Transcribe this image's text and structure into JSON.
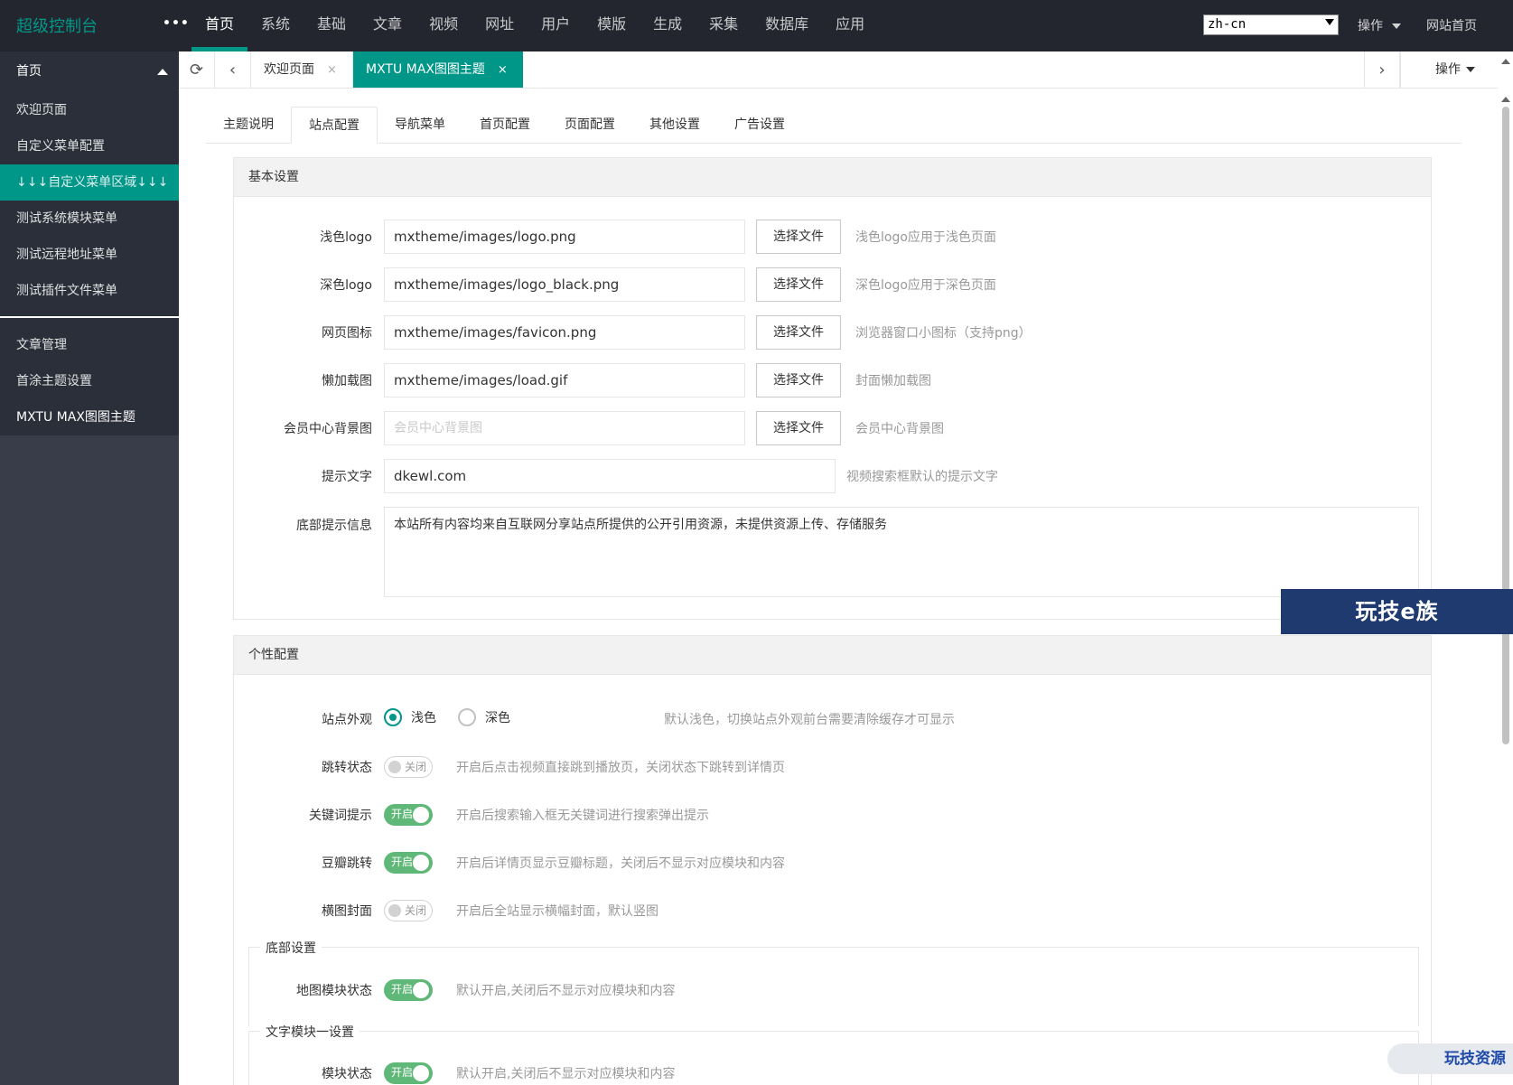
{
  "header": {
    "logo": "超级控制台",
    "more": "•••",
    "nav": [
      "首页",
      "系统",
      "基础",
      "文章",
      "视频",
      "网址",
      "用户",
      "模版",
      "生成",
      "采集",
      "数据库",
      "应用"
    ],
    "lang_value": "zh-cn",
    "operate": "操作",
    "site_home": "网站首页"
  },
  "sidebar": {
    "head": "首页",
    "group1": [
      "欢迎页面",
      "自定义菜单配置",
      "↓↓↓自定义菜单区域↓↓↓",
      "测试系统模块菜单",
      "测试远程地址菜单",
      "测试插件文件菜单"
    ],
    "group2": [
      "文章管理",
      "首涂主题设置",
      "MXTU MAX图图主题"
    ]
  },
  "tabbar": {
    "tabs": [
      "欢迎页面",
      "MXTU MAX图图主题"
    ],
    "close": "×",
    "operate": "操作"
  },
  "content_tabs": [
    "主题说明",
    "站点配置",
    "导航菜单",
    "首页配置",
    "页面配置",
    "其他设置",
    "广告设置"
  ],
  "basic": {
    "title": "基本设置",
    "choose_file": "选择文件",
    "fields": [
      {
        "label": "浅色logo",
        "value": "mxtheme/images/logo.png",
        "tip": "浅色logo应用于浅色页面"
      },
      {
        "label": "深色logo",
        "value": "mxtheme/images/logo_black.png",
        "tip": "深色logo应用于深色页面"
      },
      {
        "label": "网页图标",
        "value": "mxtheme/images/favicon.png",
        "tip": "浏览器窗口小图标（支持png）"
      },
      {
        "label": "懒加载图",
        "value": "mxtheme/images/load.gif",
        "tip": "封面懒加载图"
      },
      {
        "label": "会员中心背景图",
        "placeholder": "会员中心背景图",
        "tip": "会员中心背景图"
      }
    ],
    "hint": {
      "label": "提示文字",
      "value": "dkewl.com",
      "tip": "视频搜索框默认的提示文字"
    },
    "footer": {
      "label": "底部提示信息",
      "value": "本站所有内容均来自互联网分享站点所提供的公开引用资源，未提供资源上传、存储服务"
    }
  },
  "personal": {
    "title": "个性配置",
    "appearance": {
      "label": "站点外观",
      "light": "浅色",
      "dark": "深色",
      "tip": "默认浅色，切换站点外观前台需要清除缓存才可显示"
    },
    "switches": [
      {
        "label": "跳转状态",
        "state": "关闭",
        "on": false,
        "tip": "开启后点击视频直接跳到播放页，关闭状态下跳转到详情页"
      },
      {
        "label": "关键词提示",
        "state": "开启",
        "on": true,
        "tip": "开启后搜索输入框无关键词进行搜索弹出提示"
      },
      {
        "label": "豆瓣跳转",
        "state": "开启",
        "on": true,
        "tip": "开启后详情页显示豆瓣标题，关闭后不显示对应模块和内容"
      },
      {
        "label": "横图封面",
        "state": "关闭",
        "on": false,
        "tip": "开启后全站显示横幅封面，默认竖图"
      }
    ],
    "bottom_legend": "底部设置",
    "map_switch": {
      "label": "地图模块状态",
      "state": "开启",
      "tip": "默认开启,关闭后不显示对应模块和内容"
    },
    "text_legend": "文字模块一设置",
    "text_switch": {
      "label": "模块状态",
      "state": "开启",
      "tip": "默认开启,关闭后不显示对应模块和内容"
    }
  },
  "watermarks": {
    "banner": "玩技e族",
    "badge": "玩技资源"
  },
  "colors": {
    "accent": "#009688",
    "switch_on": "#5fb878",
    "header_bg": "#23262e",
    "sidebar_bg": "#393d49"
  }
}
